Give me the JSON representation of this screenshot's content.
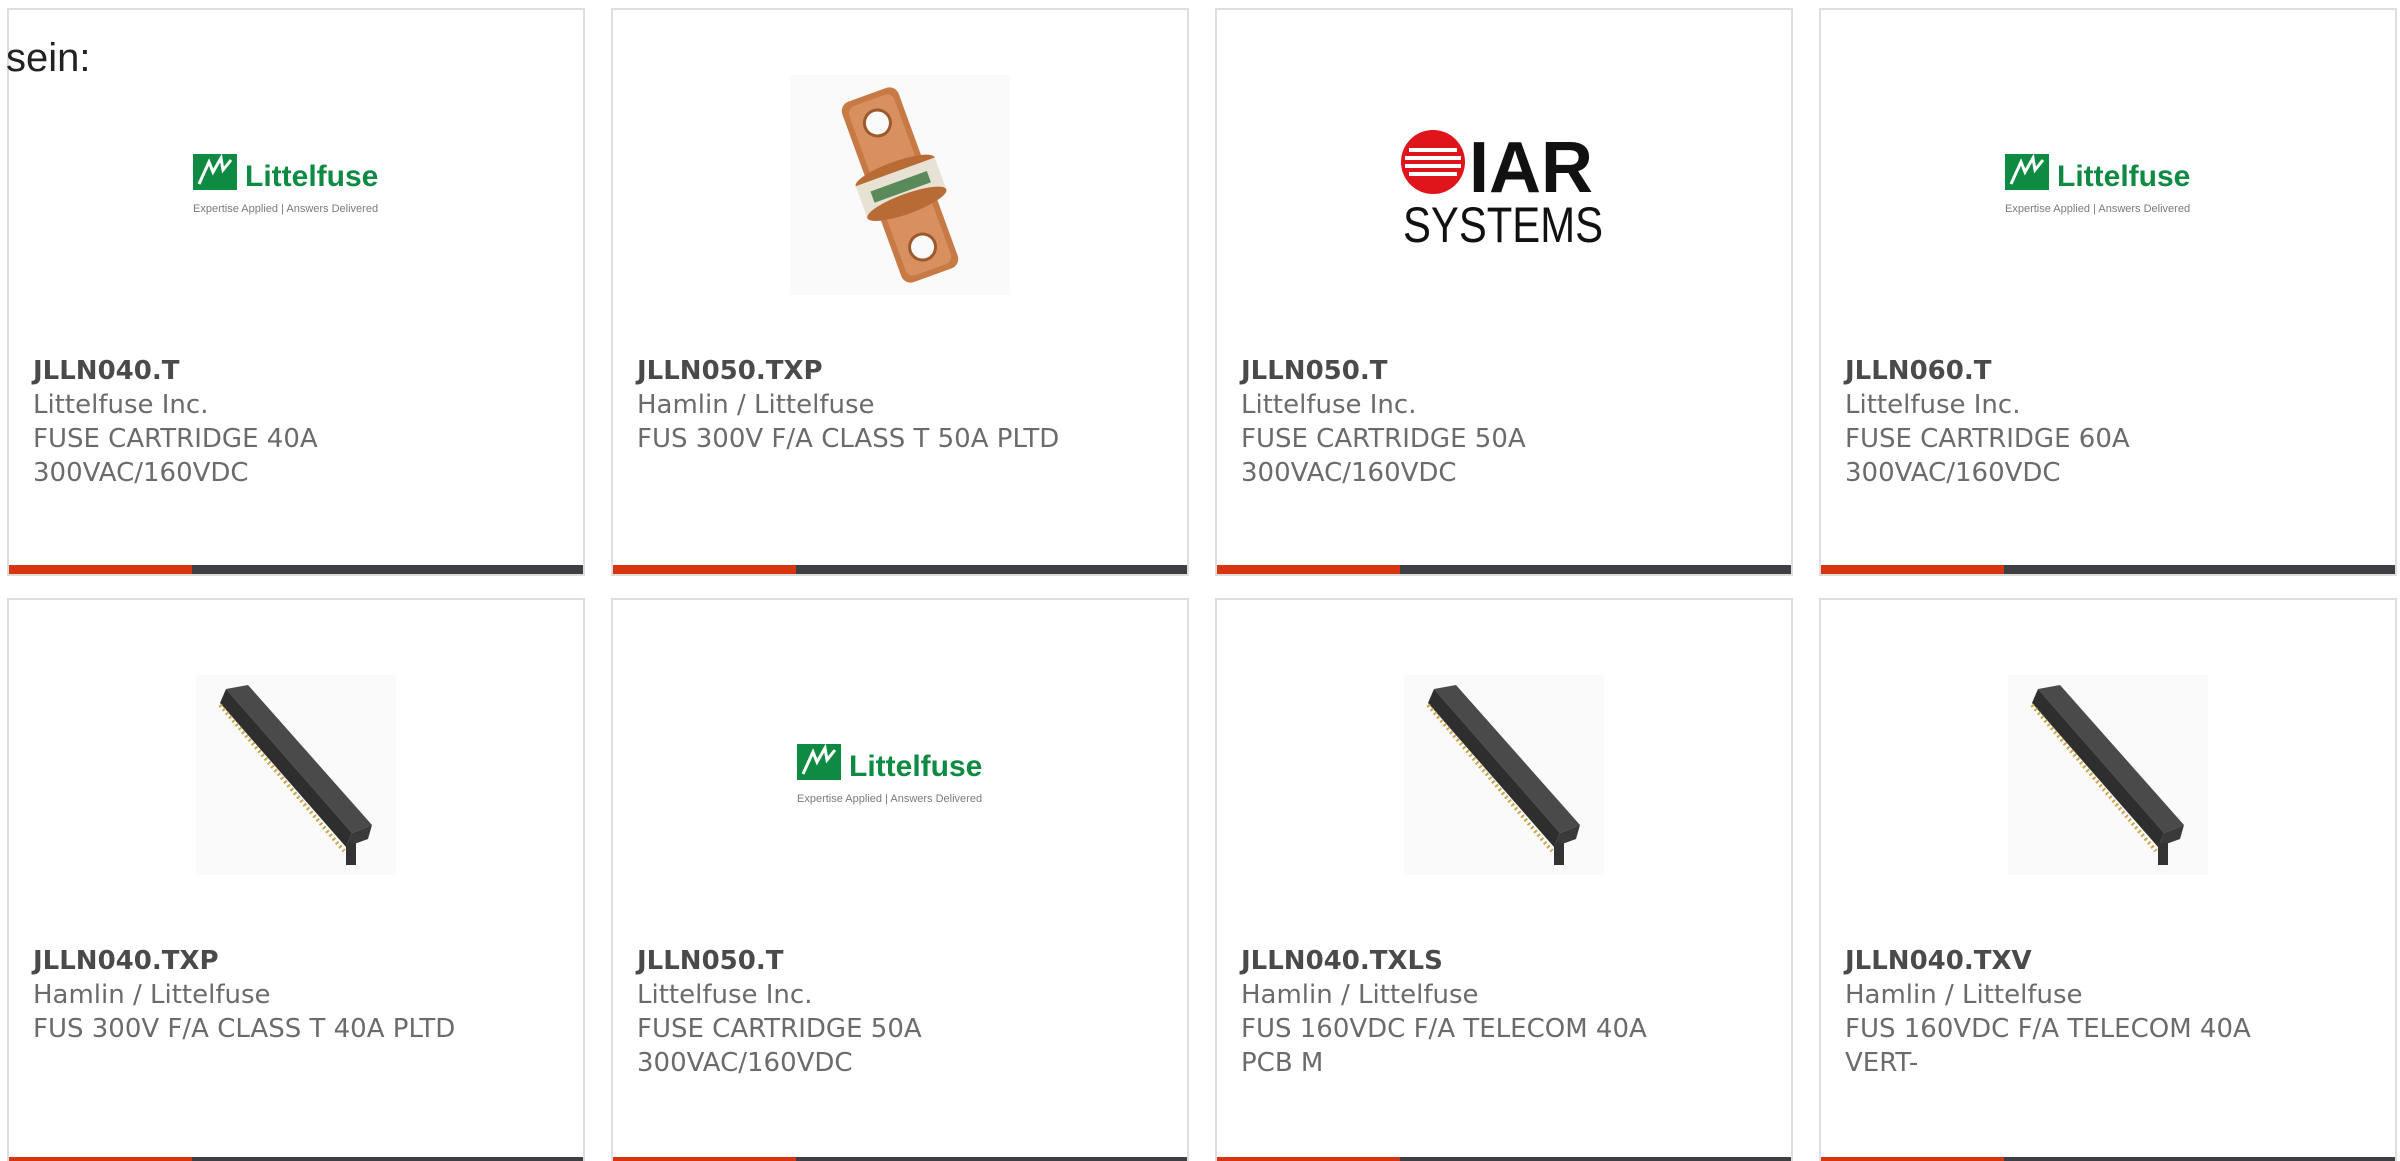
{
  "intro_text": "sein:",
  "colors": {
    "accent": "#d7340f",
    "bar": "#3d3f42",
    "littelfuse_green": "#0f8a43",
    "iar_red": "#e0141b"
  },
  "products": [
    {
      "part": "JLLN040.T",
      "maker": "Littelfuse Inc.",
      "desc1": "FUSE CARTRIDGE 40A",
      "desc2": "300VAC/160VDC",
      "image": "littelfuse-logo"
    },
    {
      "part": "JLLN050.TXP",
      "maker": "Hamlin / Littelfuse",
      "desc1": "FUS 300V F/A CLASS T 50A PLTD",
      "desc2": "",
      "image": "copper-fuse"
    },
    {
      "part": "JLLN050.T",
      "maker": "Littelfuse Inc.",
      "desc1": "FUSE CARTRIDGE 50A",
      "desc2": "300VAC/160VDC",
      "image": "iar-systems-logo"
    },
    {
      "part": "JLLN060.T",
      "maker": "Littelfuse Inc.",
      "desc1": "FUSE CARTRIDGE 60A",
      "desc2": "300VAC/160VDC",
      "image": "littelfuse-logo"
    },
    {
      "part": "JLLN040.TXP",
      "maker": "Hamlin / Littelfuse",
      "desc1": "FUS 300V F/A CLASS T 40A PLTD",
      "desc2": "",
      "image": "header-connector"
    },
    {
      "part": "JLLN050.T",
      "maker": "Littelfuse Inc.",
      "desc1": "FUSE CARTRIDGE 50A",
      "desc2": "300VAC/160VDC",
      "image": "littelfuse-logo"
    },
    {
      "part": "JLLN040.TXLS",
      "maker": "Hamlin / Littelfuse",
      "desc1": "FUS 160VDC F/A TELECOM 40A",
      "desc2": "PCB M",
      "image": "header-connector"
    },
    {
      "part": "JLLN040.TXV",
      "maker": "Hamlin / Littelfuse",
      "desc1": "FUS 160VDC F/A TELECOM 40A",
      "desc2": "VERT-",
      "image": "header-connector"
    }
  ],
  "logos": {
    "littelfuse_name": "Littelfuse",
    "littelfuse_tagline": "Expertise Applied | Answers Delivered",
    "iar_top": "IAR",
    "iar_bottom": "SYSTEMS"
  }
}
